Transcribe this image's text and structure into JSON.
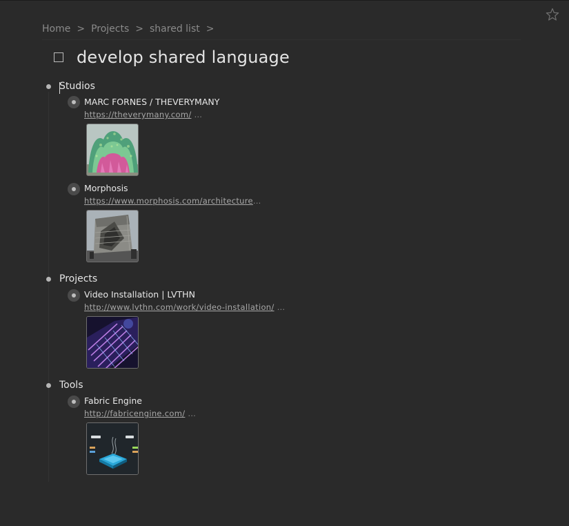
{
  "breadcrumb": {
    "items": [
      "Home",
      "Projects",
      "shared list"
    ],
    "separator": ">"
  },
  "page": {
    "title": "develop shared language"
  },
  "sections": [
    {
      "label": "Studios",
      "items": [
        {
          "title": "MARC FORNES / THEVERYMANY",
          "url": "https://theverymany.com/",
          "more": "…",
          "thumb_icon": "pavilion-photo"
        },
        {
          "title": "Morphosis",
          "url": "https://www.morphosis.com/architecture",
          "more": "…",
          "thumb_icon": "building-photo"
        }
      ]
    },
    {
      "label": "Projects",
      "items": [
        {
          "title": "Video Installation | LVTHN",
          "url": "http://www.lvthn.com/work/video-installation/",
          "more": "…",
          "thumb_icon": "installation-photo"
        }
      ]
    },
    {
      "label": "Tools",
      "items": [
        {
          "title": "Fabric Engine",
          "url": "http://fabricengine.com/",
          "more": "…",
          "thumb_icon": "software-screenshot"
        }
      ]
    }
  ],
  "colors": {
    "background": "#2a2a2a",
    "text": "#e6e6e6",
    "muted": "#8a8a8a",
    "link": "#a8a8a8"
  }
}
